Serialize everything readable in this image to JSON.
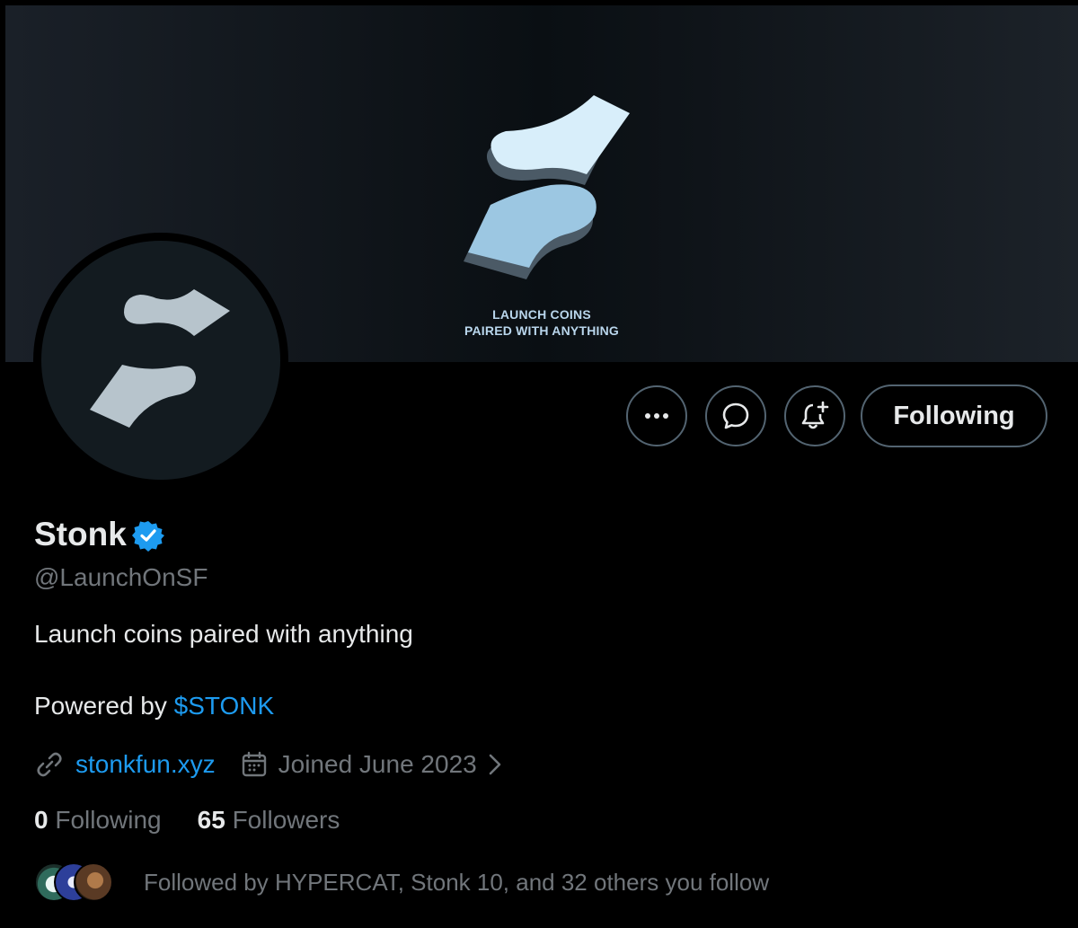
{
  "banner": {
    "tagline_line1": "LAUNCH COINS",
    "tagline_line2": "PAIRED WITH ANYTHING"
  },
  "actions": {
    "more_icon": "more-horizontal-icon",
    "message_icon": "message-bubble-icon",
    "notify_icon": "bell-plus-icon",
    "following_label": "Following"
  },
  "profile": {
    "name": "Stonk",
    "handle": "@LaunchOnSF",
    "bio": "Launch coins paired with anything",
    "powered_prefix": "Powered by ",
    "powered_cashtag": "$STONK",
    "website": "stonkfun.xyz",
    "joined": "Joined June 2023",
    "following_count": "0",
    "following_label": " Following",
    "followers_count": "65",
    "followers_label": " Followers",
    "followed_by": "Followed by HYPERCAT, Stonk 10, and 32 others you follow",
    "followed_avatars": [
      "hypercat-avatar",
      "stonk10-avatar",
      "third-avatar"
    ]
  },
  "colors": {
    "background": "#000000",
    "accent": "#1d9bf0",
    "muted": "#71767b",
    "text": "#e7e9ea",
    "logo_light": "#cfe8f7",
    "logo_shadow": "#5d6f7c"
  }
}
